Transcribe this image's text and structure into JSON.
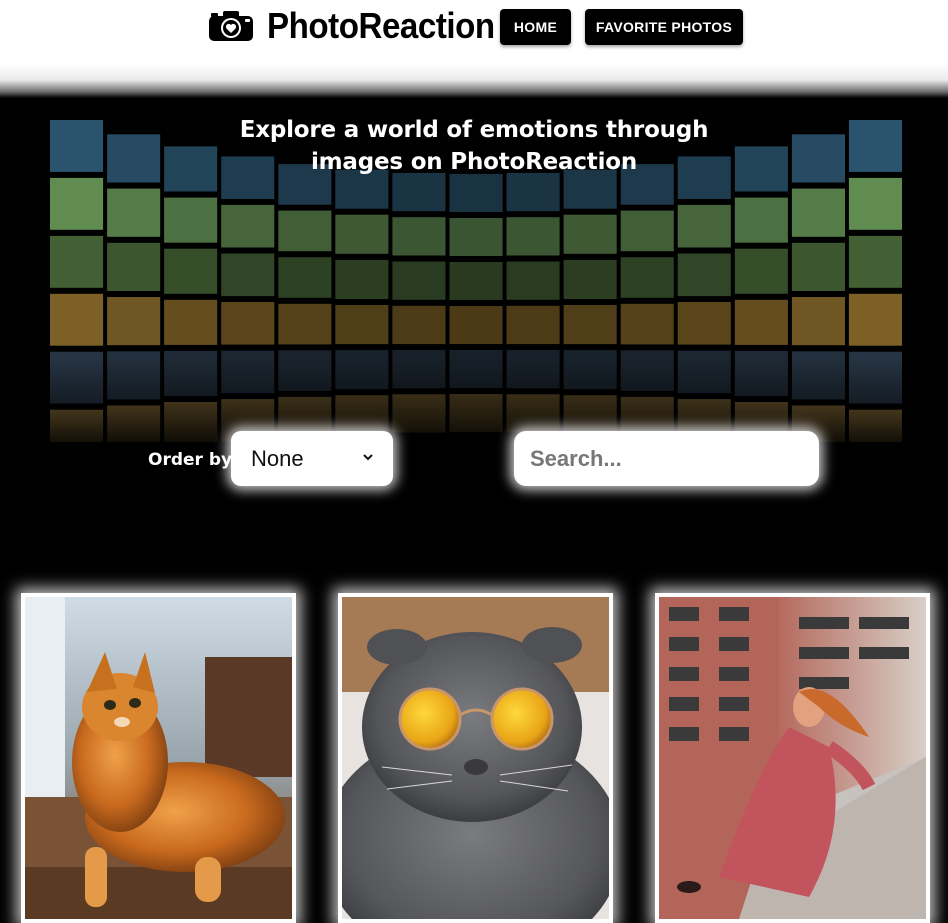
{
  "header": {
    "brand": "PhotoReaction",
    "nav": [
      {
        "label": "HOME"
      },
      {
        "label": "FAVORITE PHOTOS"
      }
    ]
  },
  "hero": {
    "title_line1": "Explore a world of emotions through",
    "title_line2": "images on PhotoReaction"
  },
  "controls": {
    "order_label": "Order by",
    "order_value": "None",
    "search_placeholder": "Search..."
  },
  "photos": [
    {
      "subject": "orange-cat",
      "icon": "cat-photo"
    },
    {
      "subject": "gray-cat-with-sunglasses",
      "icon": "cat-sunglasses-photo"
    },
    {
      "subject": "woman-in-pink-dress",
      "icon": "woman-photo"
    }
  ],
  "colors": {
    "header_bg": "#ffffff",
    "page_bg": "#000000",
    "button_bg": "#000000",
    "button_text": "#ffffff"
  }
}
